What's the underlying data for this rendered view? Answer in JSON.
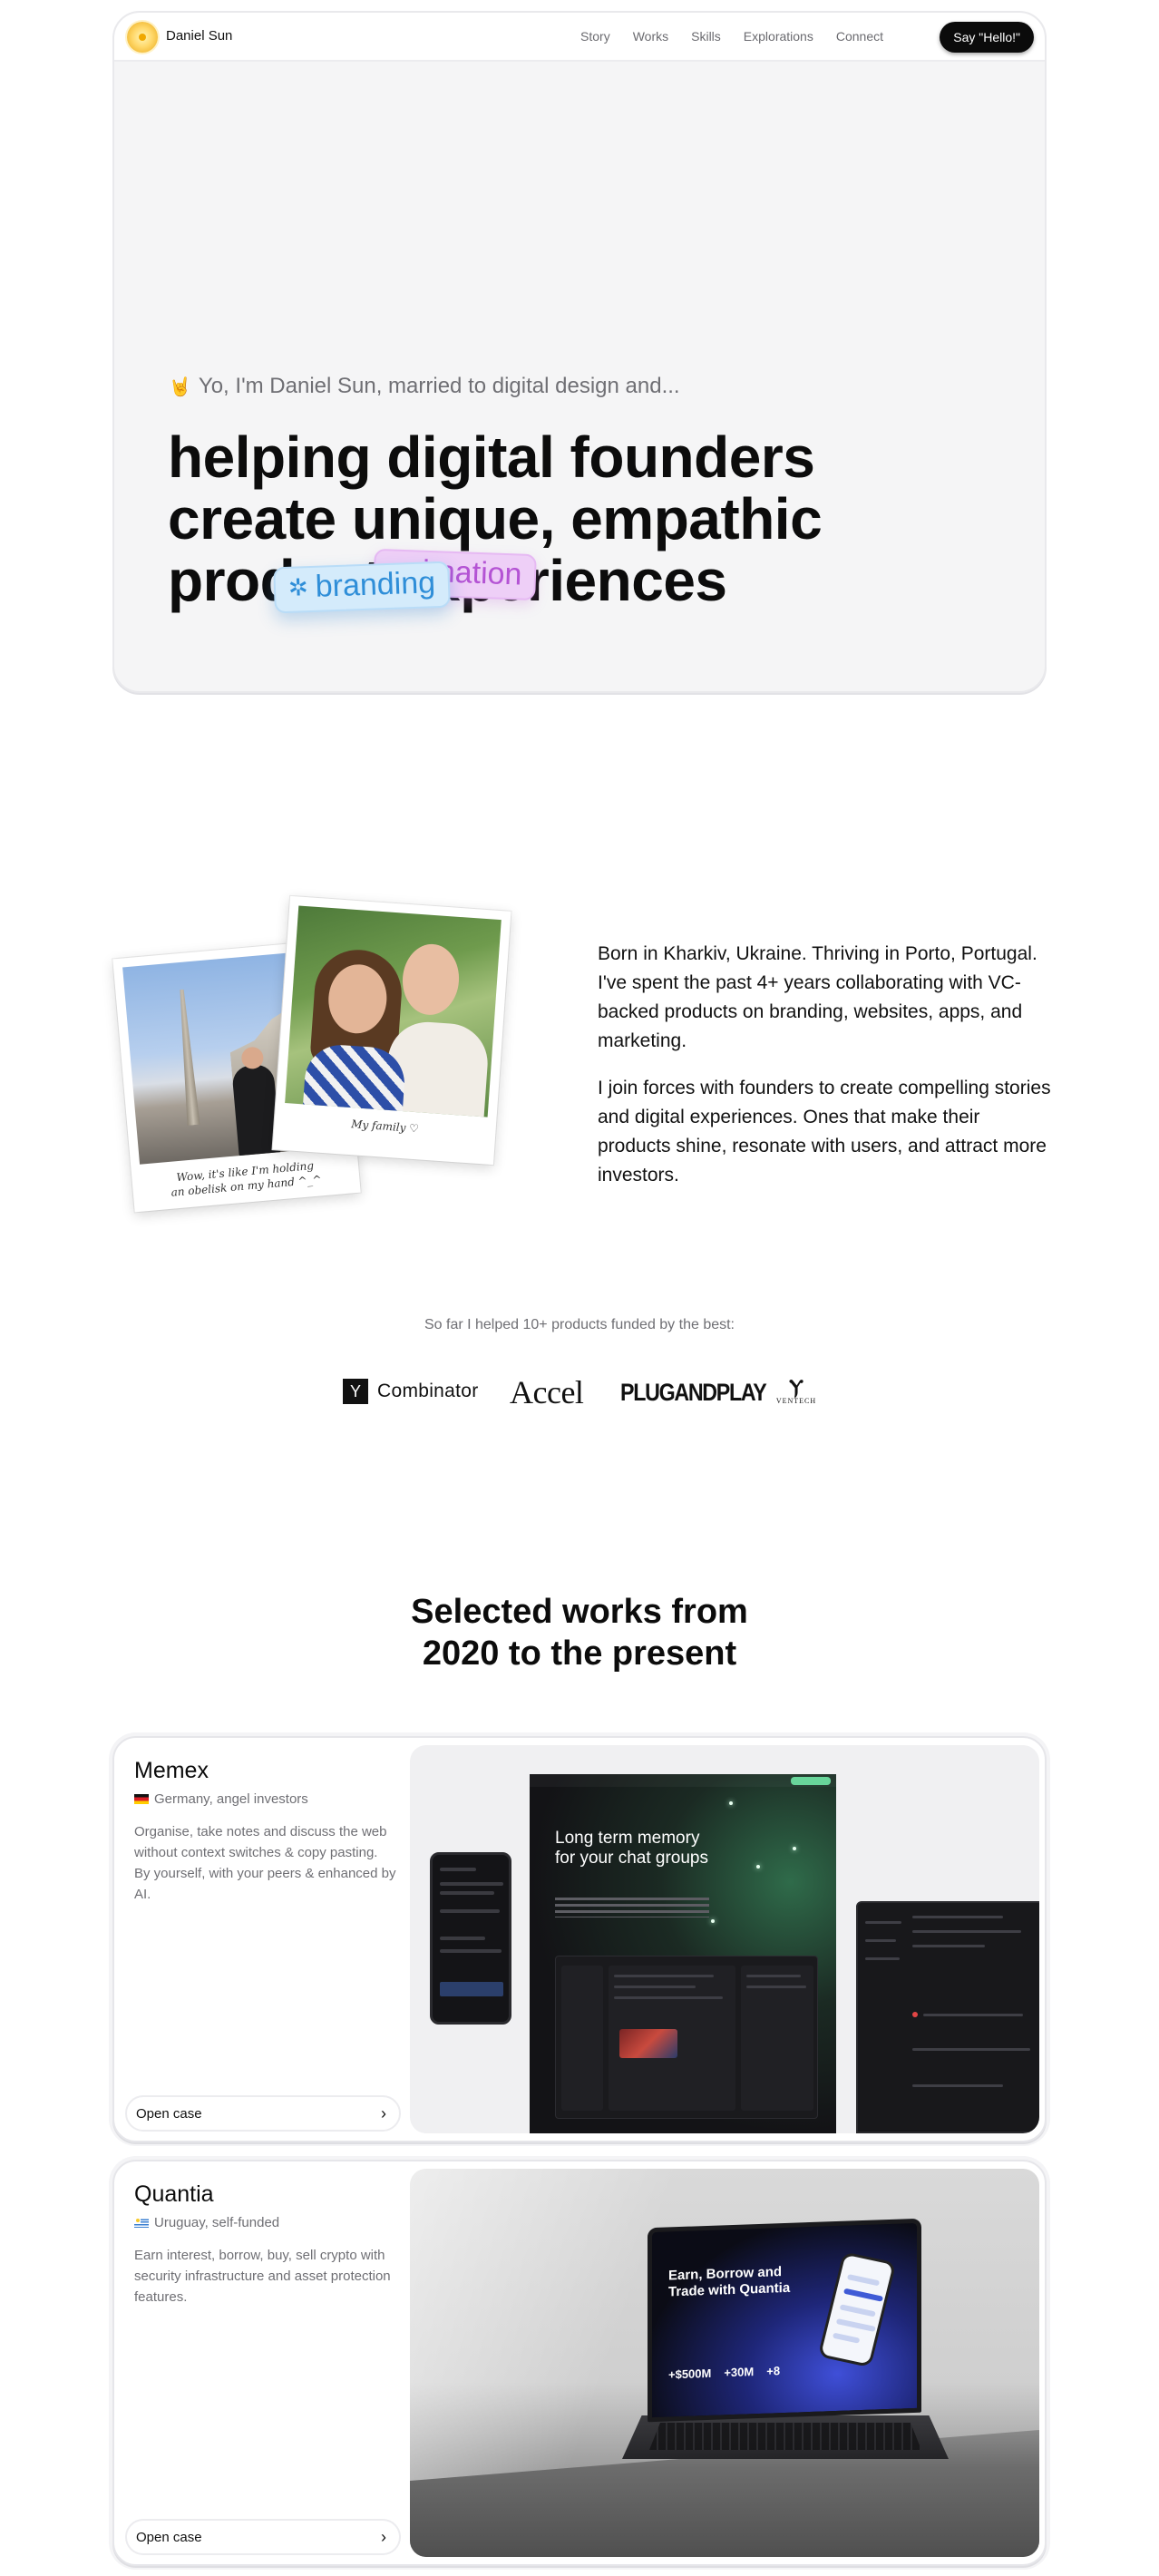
{
  "nav": {
    "brand_name": "Daniel Sun",
    "links": [
      "Story",
      "Works",
      "Skills",
      "Explorations",
      "Connect"
    ],
    "cta_label": "Say \"Hello!\""
  },
  "hero": {
    "intro_emoji": "🤘",
    "intro_text": "Yo, I'm Daniel Sun, married to digital design and...",
    "headline_lines": [
      "helping digital founders",
      "create unique, empathic",
      "product experiences"
    ],
    "chip_animation": "animation",
    "chip_branding": "branding",
    "chip_branding_icon": "✲"
  },
  "about": {
    "photo_1_caption_line1": "Wow, it's like I'm holding",
    "photo_1_caption_line2": "an obelisk on my hand ^_^",
    "photo_2_caption": "My family ♡",
    "paragraph_1": "Born in Kharkiv, Ukraine. Thriving in Porto, Portugal. I've spent the past 4+ years collaborating with VC-backed products on branding, websites, apps, and marketing.",
    "paragraph_2": "I join forces with founders to create compelling stories and digital experiences. Ones that make their products shine, resonate with users, and attract more investors."
  },
  "funded": {
    "line": "So far I helped 10+ products funded by the best:",
    "logos": {
      "yc_mark": "Y",
      "yc_text": "Combinator",
      "accel": "Accel",
      "pnp": "PLUGANDPLAY",
      "ventech_mark": "Ⲩ",
      "ventech_text": "VENTECH"
    }
  },
  "works": {
    "title_line1": "Selected works from",
    "title_line2": "2020 to the present",
    "items": [
      {
        "name": "Memex",
        "meta": "Germany, angel investors",
        "description": "Organise, take notes and discuss the web without context switches & copy pasting. By yourself, with your peers & enhanced by AI.",
        "cta": "Open case",
        "preview_headline": "Long term memory for your chat groups"
      },
      {
        "name": "Quantia",
        "meta": "Uruguay, self-funded",
        "description": "Earn interest, borrow, buy, sell crypto with security infrastructure and asset protection features.",
        "cta": "Open case",
        "preview_headline": "Earn, Borrow and Trade with Quantia",
        "preview_stats": [
          "+$500M",
          "+30M",
          "+8"
        ]
      }
    ]
  },
  "colors": {
    "accent_dark": "#0b0b0b",
    "chip_animation_bg": "#eecff7",
    "chip_branding_bg": "#d4ebfb",
    "muted_text": "#6f6f74"
  }
}
